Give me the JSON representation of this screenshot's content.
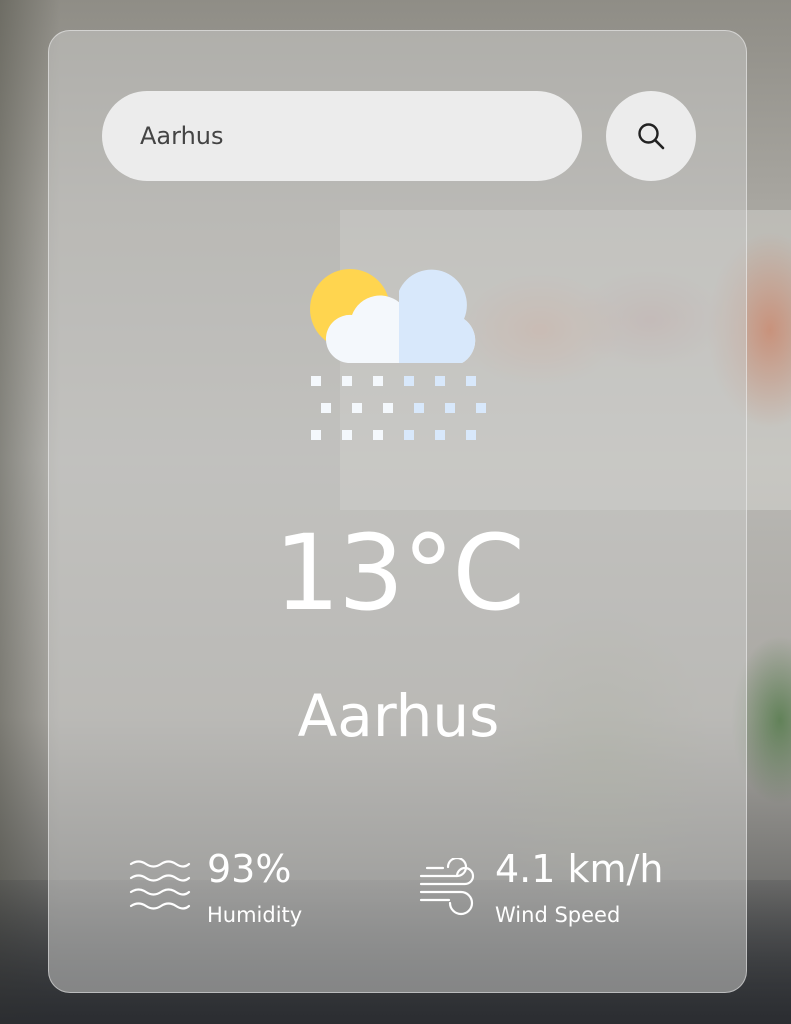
{
  "search": {
    "value": "Aarhus",
    "icon": "search-icon"
  },
  "weather": {
    "icon": "snow-sun-cloud-icon",
    "temperature": "13°C",
    "city": "Aarhus"
  },
  "stats": {
    "humidity": {
      "value": "93%",
      "label": "Humidity",
      "icon": "humidity-waves-icon"
    },
    "wind": {
      "value": "4.1 km/h",
      "label": "Wind Speed",
      "icon": "wind-icon"
    }
  },
  "colors": {
    "card": "#c8c8c6",
    "search_field": "#ececec",
    "text": "#ffffff",
    "sun": "#ffd54f",
    "cloud_light": "#f4f8fc",
    "cloud_shade": "#d8e8fb"
  }
}
